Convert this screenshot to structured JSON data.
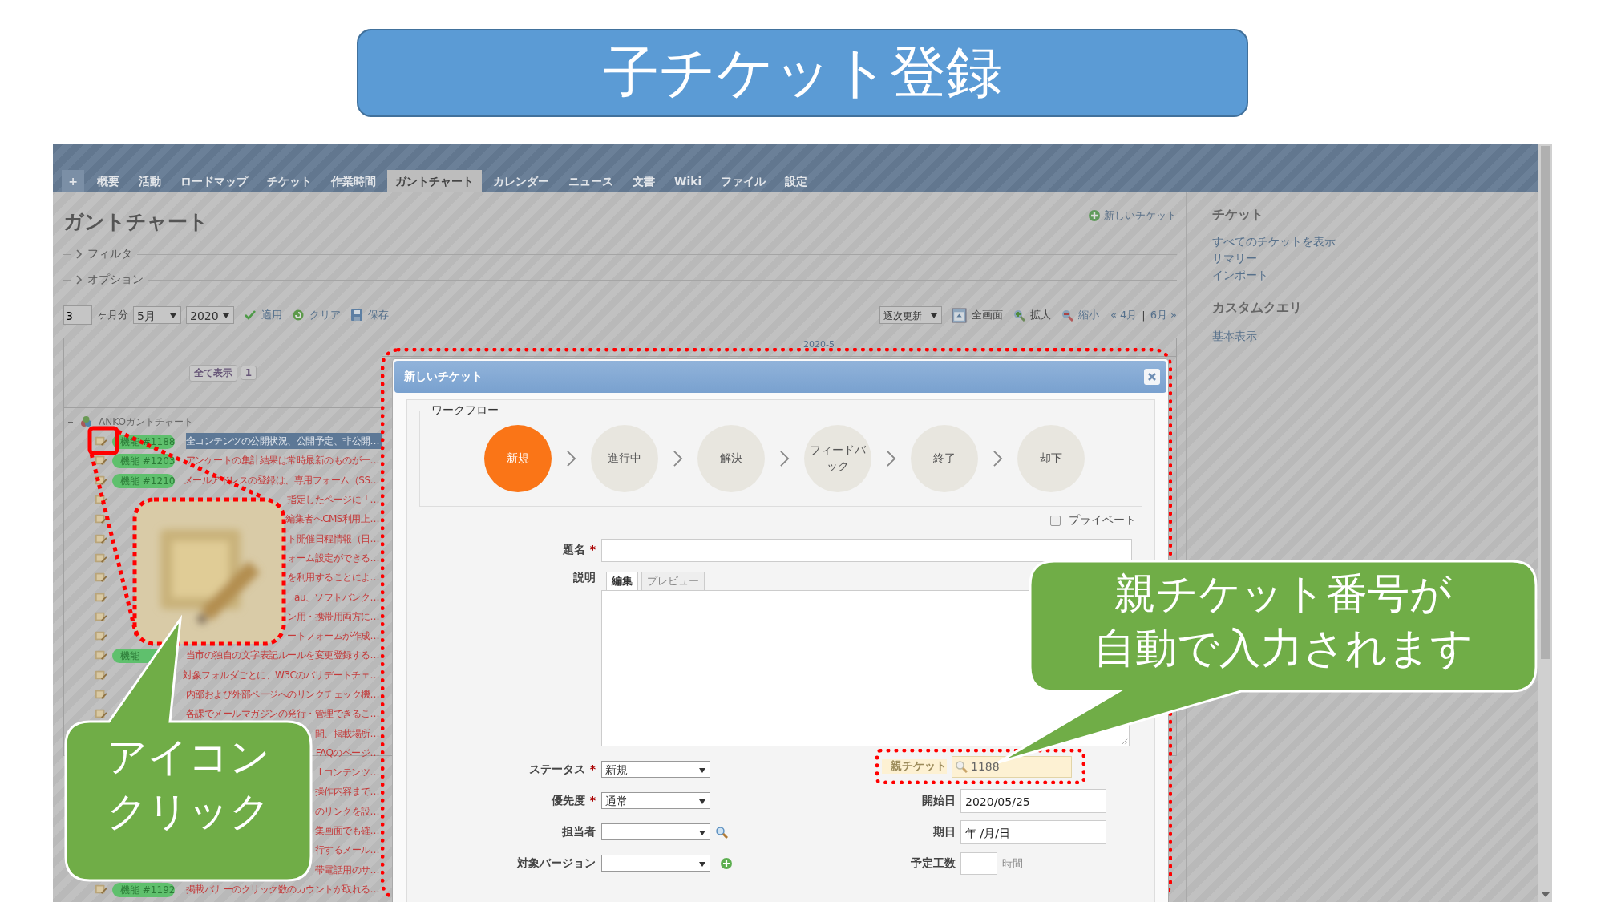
{
  "slide_title": "子チケット登録",
  "nav": {
    "tabs": [
      {
        "label": "+",
        "selected": false
      },
      {
        "label": "概要",
        "selected": false
      },
      {
        "label": "活動",
        "selected": false
      },
      {
        "label": "ロードマップ",
        "selected": false
      },
      {
        "label": "チケット",
        "selected": false
      },
      {
        "label": "作業時間",
        "selected": false
      },
      {
        "label": "ガントチャート",
        "selected": true
      },
      {
        "label": "カレンダー",
        "selected": false
      },
      {
        "label": "ニュース",
        "selected": false
      },
      {
        "label": "文書",
        "selected": false
      },
      {
        "label": "Wiki",
        "selected": false
      },
      {
        "label": "ファイル",
        "selected": false
      },
      {
        "label": "設定",
        "selected": false
      }
    ]
  },
  "page_title": "ガントチャート",
  "new_ticket_link": "新しいチケット",
  "sections": [
    {
      "label": "フィルタ",
      "expanded": false
    },
    {
      "label": "オプション",
      "expanded": false
    }
  ],
  "controls": {
    "months": "3",
    "months_label": "ヶ月分",
    "month": "5月",
    "year": "2020",
    "apply": "適用",
    "clear": "クリア",
    "save": "保存",
    "refresh_mode": "逐次更新",
    "fullscreen": "全画面",
    "zoom_in": "拡大",
    "zoom_out": "縮小",
    "prev": "« 4月",
    "separator": "|",
    "next": "6月 »"
  },
  "gantt": {
    "show_all": "全て表示",
    "count": "1",
    "header": "2020-5",
    "project": "ANKOガントチャート",
    "rows": [
      {
        "icon": true,
        "tag": "機能 #1188",
        "subject": "全コンテンツの公開状況、公開予定、非公開…",
        "selected": true
      },
      {
        "icon": true,
        "tag": "機能 #1203",
        "subject": "アンケートの集計結果は常時最新のものが一…",
        "selected": false
      },
      {
        "icon": true,
        "tag": "機能 #1210",
        "subject": "メールアドレスの登録は、専用フォーム（SS…",
        "selected": false
      },
      {
        "icon": true,
        "subject": "指定したページに「…",
        "selected": false
      },
      {
        "icon": true,
        "subject": "編集者へCMS利用上…",
        "selected": false
      },
      {
        "icon": true,
        "subject": "ト開催日程情報（日…",
        "selected": false
      },
      {
        "icon": true,
        "subject": "ォーム設定ができる…",
        "selected": false
      },
      {
        "icon": true,
        "subject": "を利用することによ…",
        "selected": false
      },
      {
        "icon": true,
        "subject": "au、ソフトバンク…",
        "selected": false
      },
      {
        "icon": true,
        "subject": "ン用・携帯用両方に…",
        "selected": false
      },
      {
        "icon": true,
        "subject": "ートフォームが作成…",
        "selected": false
      },
      {
        "icon": true,
        "tag": "機能",
        "subject": "当市の独自の文字表記ルールを変更登録する…",
        "selected": false
      },
      {
        "icon": true,
        "subject": "対象フォルダごとに、W3Cのバリデートチェ…",
        "selected": false
      },
      {
        "icon": true,
        "subject": "内部および外部ページへのリンクチェック機…",
        "selected": false
      },
      {
        "icon": true,
        "subject": "各課でメールマガジンの発行・管理できるこ…",
        "selected": false
      },
      {
        "subject": "間、掲載場所…",
        "selected": false
      },
      {
        "subject": "FAQのページ…",
        "selected": false
      },
      {
        "subject": "Lコンテンツ…",
        "selected": false
      },
      {
        "subject": "操作内容まで…",
        "selected": false
      },
      {
        "subject": "のリンクを設…",
        "selected": false
      },
      {
        "subject": "集画面でも確…",
        "selected": false
      },
      {
        "subject": "行するメール…",
        "selected": false
      },
      {
        "subject": "帯電話用のサ…",
        "selected": false
      },
      {
        "icon": true,
        "tag": "機能 #1192",
        "subject": "掲載バナーのクリック数のカウントが取れる…",
        "selected": false
      }
    ]
  },
  "sidebar": {
    "heading": "チケット",
    "links": [
      "すべてのチケットを表示",
      "サマリー",
      "インポート"
    ],
    "queries_heading": "カスタムクエリ",
    "queries": [
      "基本表示"
    ]
  },
  "modal": {
    "title": "新しいチケット",
    "workflow": {
      "legend": "ワークフロー",
      "steps": [
        {
          "label": "新規",
          "selected": true
        },
        {
          "label": "進行中",
          "selected": false
        },
        {
          "label": "解決",
          "selected": false
        },
        {
          "label": "フィードバック",
          "selected": false
        },
        {
          "label": "終了",
          "selected": false
        },
        {
          "label": "却下",
          "selected": false
        }
      ]
    },
    "private": {
      "label": "プライベート",
      "checked": false
    },
    "subject": {
      "label": "題名",
      "mark": "*"
    },
    "description": {
      "label": "説明",
      "tabs": [
        {
          "label": "編集",
          "selected": true
        },
        {
          "label": "プレビュー",
          "selected": false
        }
      ]
    },
    "left_fields": [
      {
        "label": "ステータス",
        "mark": "*",
        "value": "新規",
        "kind": "plain"
      },
      {
        "label": "優先度",
        "mark": "*",
        "value": "通常",
        "kind": "plain"
      },
      {
        "label": "担当者",
        "kind": "search"
      },
      {
        "label": "対象バージョン",
        "kind": "add"
      }
    ],
    "right_fields": [
      {
        "label": "親チケット",
        "kind": "parent",
        "value": "1188",
        "highlighted": true
      },
      {
        "label": "開始日",
        "kind": "text",
        "value": "2020/05/25"
      },
      {
        "label": "期日",
        "kind": "text",
        "value": "年 /月/日"
      },
      {
        "label": "予定工数",
        "kind": "hours",
        "unit": "時間"
      }
    ]
  },
  "parent_callout": {
    "lines": [
      "親チケット番号が",
      "自動で入力されます"
    ]
  },
  "icon_callout": {
    "lines": [
      "アイコン",
      "クリック"
    ]
  }
}
